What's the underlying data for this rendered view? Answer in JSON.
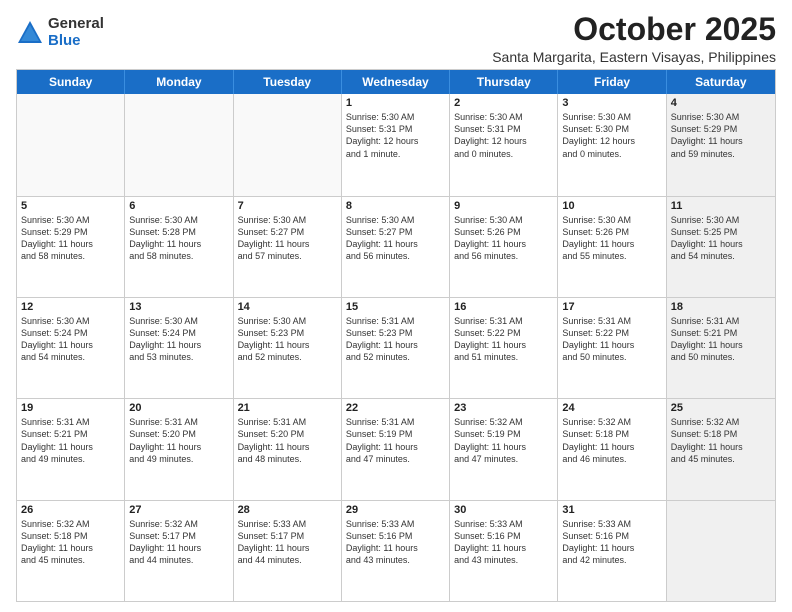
{
  "logo": {
    "general": "General",
    "blue": "Blue"
  },
  "title": "October 2025",
  "subtitle": "Santa Margarita, Eastern Visayas, Philippines",
  "weekdays": [
    "Sunday",
    "Monday",
    "Tuesday",
    "Wednesday",
    "Thursday",
    "Friday",
    "Saturday"
  ],
  "weeks": [
    [
      {
        "day": "",
        "empty": true
      },
      {
        "day": "",
        "empty": true
      },
      {
        "day": "",
        "empty": true
      },
      {
        "day": "1",
        "line1": "Sunrise: 5:30 AM",
        "line2": "Sunset: 5:31 PM",
        "line3": "Daylight: 12 hours",
        "line4": "and 1 minute."
      },
      {
        "day": "2",
        "line1": "Sunrise: 5:30 AM",
        "line2": "Sunset: 5:31 PM",
        "line3": "Daylight: 12 hours",
        "line4": "and 0 minutes."
      },
      {
        "day": "3",
        "line1": "Sunrise: 5:30 AM",
        "line2": "Sunset: 5:30 PM",
        "line3": "Daylight: 12 hours",
        "line4": "and 0 minutes."
      },
      {
        "day": "4",
        "line1": "Sunrise: 5:30 AM",
        "line2": "Sunset: 5:29 PM",
        "line3": "Daylight: 11 hours",
        "line4": "and 59 minutes.",
        "shaded": true
      }
    ],
    [
      {
        "day": "5",
        "line1": "Sunrise: 5:30 AM",
        "line2": "Sunset: 5:29 PM",
        "line3": "Daylight: 11 hours",
        "line4": "and 58 minutes."
      },
      {
        "day": "6",
        "line1": "Sunrise: 5:30 AM",
        "line2": "Sunset: 5:28 PM",
        "line3": "Daylight: 11 hours",
        "line4": "and 58 minutes."
      },
      {
        "day": "7",
        "line1": "Sunrise: 5:30 AM",
        "line2": "Sunset: 5:27 PM",
        "line3": "Daylight: 11 hours",
        "line4": "and 57 minutes."
      },
      {
        "day": "8",
        "line1": "Sunrise: 5:30 AM",
        "line2": "Sunset: 5:27 PM",
        "line3": "Daylight: 11 hours",
        "line4": "and 56 minutes."
      },
      {
        "day": "9",
        "line1": "Sunrise: 5:30 AM",
        "line2": "Sunset: 5:26 PM",
        "line3": "Daylight: 11 hours",
        "line4": "and 56 minutes."
      },
      {
        "day": "10",
        "line1": "Sunrise: 5:30 AM",
        "line2": "Sunset: 5:26 PM",
        "line3": "Daylight: 11 hours",
        "line4": "and 55 minutes."
      },
      {
        "day": "11",
        "line1": "Sunrise: 5:30 AM",
        "line2": "Sunset: 5:25 PM",
        "line3": "Daylight: 11 hours",
        "line4": "and 54 minutes.",
        "shaded": true
      }
    ],
    [
      {
        "day": "12",
        "line1": "Sunrise: 5:30 AM",
        "line2": "Sunset: 5:24 PM",
        "line3": "Daylight: 11 hours",
        "line4": "and 54 minutes."
      },
      {
        "day": "13",
        "line1": "Sunrise: 5:30 AM",
        "line2": "Sunset: 5:24 PM",
        "line3": "Daylight: 11 hours",
        "line4": "and 53 minutes."
      },
      {
        "day": "14",
        "line1": "Sunrise: 5:30 AM",
        "line2": "Sunset: 5:23 PM",
        "line3": "Daylight: 11 hours",
        "line4": "and 52 minutes."
      },
      {
        "day": "15",
        "line1": "Sunrise: 5:31 AM",
        "line2": "Sunset: 5:23 PM",
        "line3": "Daylight: 11 hours",
        "line4": "and 52 minutes."
      },
      {
        "day": "16",
        "line1": "Sunrise: 5:31 AM",
        "line2": "Sunset: 5:22 PM",
        "line3": "Daylight: 11 hours",
        "line4": "and 51 minutes."
      },
      {
        "day": "17",
        "line1": "Sunrise: 5:31 AM",
        "line2": "Sunset: 5:22 PM",
        "line3": "Daylight: 11 hours",
        "line4": "and 50 minutes."
      },
      {
        "day": "18",
        "line1": "Sunrise: 5:31 AM",
        "line2": "Sunset: 5:21 PM",
        "line3": "Daylight: 11 hours",
        "line4": "and 50 minutes.",
        "shaded": true
      }
    ],
    [
      {
        "day": "19",
        "line1": "Sunrise: 5:31 AM",
        "line2": "Sunset: 5:21 PM",
        "line3": "Daylight: 11 hours",
        "line4": "and 49 minutes."
      },
      {
        "day": "20",
        "line1": "Sunrise: 5:31 AM",
        "line2": "Sunset: 5:20 PM",
        "line3": "Daylight: 11 hours",
        "line4": "and 49 minutes."
      },
      {
        "day": "21",
        "line1": "Sunrise: 5:31 AM",
        "line2": "Sunset: 5:20 PM",
        "line3": "Daylight: 11 hours",
        "line4": "and 48 minutes."
      },
      {
        "day": "22",
        "line1": "Sunrise: 5:31 AM",
        "line2": "Sunset: 5:19 PM",
        "line3": "Daylight: 11 hours",
        "line4": "and 47 minutes."
      },
      {
        "day": "23",
        "line1": "Sunrise: 5:32 AM",
        "line2": "Sunset: 5:19 PM",
        "line3": "Daylight: 11 hours",
        "line4": "and 47 minutes."
      },
      {
        "day": "24",
        "line1": "Sunrise: 5:32 AM",
        "line2": "Sunset: 5:18 PM",
        "line3": "Daylight: 11 hours",
        "line4": "and 46 minutes."
      },
      {
        "day": "25",
        "line1": "Sunrise: 5:32 AM",
        "line2": "Sunset: 5:18 PM",
        "line3": "Daylight: 11 hours",
        "line4": "and 45 minutes.",
        "shaded": true
      }
    ],
    [
      {
        "day": "26",
        "line1": "Sunrise: 5:32 AM",
        "line2": "Sunset: 5:18 PM",
        "line3": "Daylight: 11 hours",
        "line4": "and 45 minutes."
      },
      {
        "day": "27",
        "line1": "Sunrise: 5:32 AM",
        "line2": "Sunset: 5:17 PM",
        "line3": "Daylight: 11 hours",
        "line4": "and 44 minutes."
      },
      {
        "day": "28",
        "line1": "Sunrise: 5:33 AM",
        "line2": "Sunset: 5:17 PM",
        "line3": "Daylight: 11 hours",
        "line4": "and 44 minutes."
      },
      {
        "day": "29",
        "line1": "Sunrise: 5:33 AM",
        "line2": "Sunset: 5:16 PM",
        "line3": "Daylight: 11 hours",
        "line4": "and 43 minutes."
      },
      {
        "day": "30",
        "line1": "Sunrise: 5:33 AM",
        "line2": "Sunset: 5:16 PM",
        "line3": "Daylight: 11 hours",
        "line4": "and 43 minutes."
      },
      {
        "day": "31",
        "line1": "Sunrise: 5:33 AM",
        "line2": "Sunset: 5:16 PM",
        "line3": "Daylight: 11 hours",
        "line4": "and 42 minutes."
      },
      {
        "day": "",
        "empty": true,
        "shaded": true
      }
    ]
  ]
}
